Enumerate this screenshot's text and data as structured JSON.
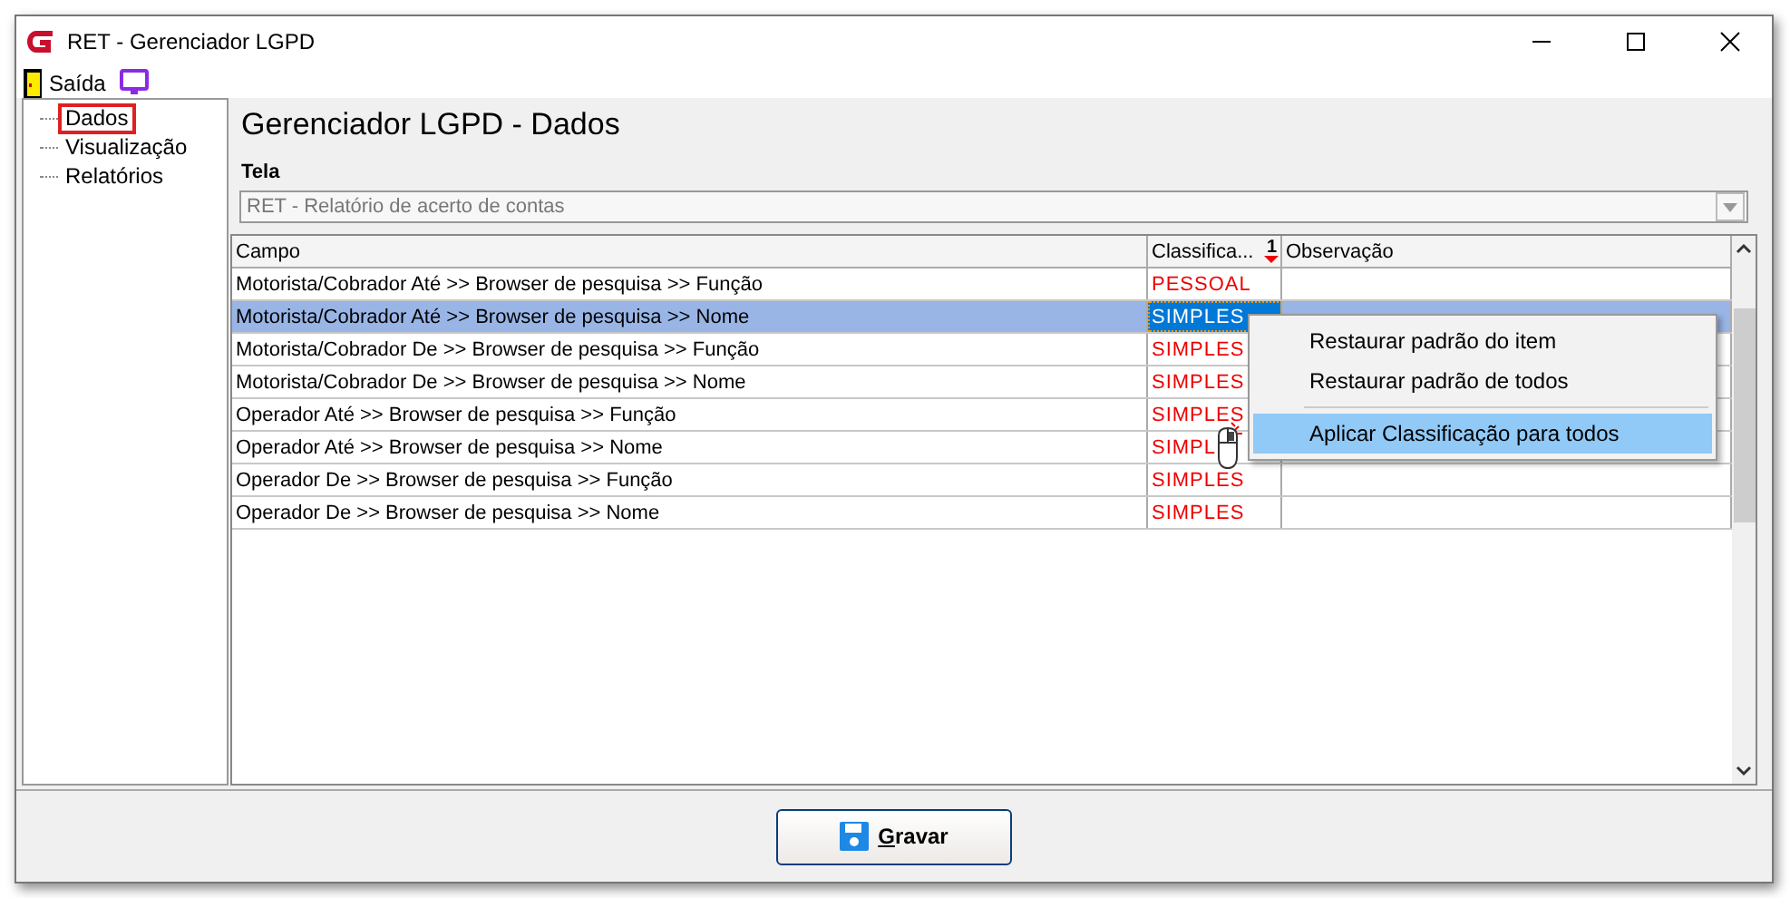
{
  "window": {
    "title": "RET - Gerenciador LGPD"
  },
  "menu": [
    {
      "label": "Saída"
    }
  ],
  "tree": {
    "items": [
      {
        "label": "Dados",
        "selected": true
      },
      {
        "label": "Visualização",
        "selected": false
      },
      {
        "label": "Relatórios",
        "selected": false
      }
    ]
  },
  "heading": "Gerenciador LGPD - Dados",
  "tela": {
    "label": "Tela",
    "value": "RET - Relatório de acerto de contas"
  },
  "table": {
    "columns": [
      {
        "label": "Campo"
      },
      {
        "label": "Classifica...",
        "sort_order": "1"
      },
      {
        "label": "Observação"
      }
    ],
    "rows": [
      {
        "campo": "Motorista/Cobrador Até >> Browser de pesquisa >> Função",
        "classificacao": "PESSOAL",
        "selected": false
      },
      {
        "campo": "Motorista/Cobrador Até >> Browser de pesquisa >> Nome",
        "classificacao": "SIMPLES",
        "selected": true
      },
      {
        "campo": "Motorista/Cobrador De >> Browser de pesquisa >> Função",
        "classificacao": "SIMPLES",
        "selected": false
      },
      {
        "campo": "Motorista/Cobrador De >> Browser de pesquisa >> Nome",
        "classificacao": "SIMPLES",
        "selected": false
      },
      {
        "campo": "Operador Até >> Browser de pesquisa >> Função",
        "classificacao": "SIMPLES",
        "selected": false
      },
      {
        "campo": "Operador Até >> Browser de pesquisa >> Nome",
        "classificacao": "SIMPL",
        "selected": false
      },
      {
        "campo": "Operador De >> Browser de pesquisa >> Função",
        "classificacao": "SIMPLES",
        "selected": false
      },
      {
        "campo": "Operador De >> Browser de pesquisa >> Nome",
        "classificacao": "SIMPLES",
        "selected": false
      }
    ]
  },
  "context_menu": {
    "items": [
      {
        "label": "Restaurar padrão do item",
        "selected": false
      },
      {
        "label": "Restaurar padrão de todos",
        "selected": false
      },
      {
        "label": "Aplicar Classificação para todos",
        "selected": true
      }
    ]
  },
  "save_button": {
    "label": "Gravar"
  }
}
